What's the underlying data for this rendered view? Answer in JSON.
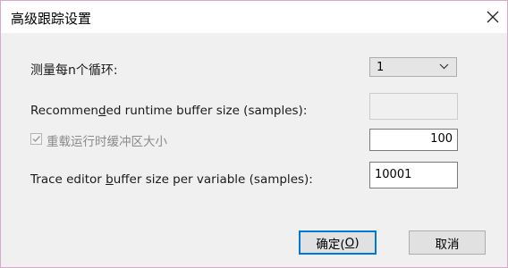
{
  "dialog": {
    "title": "高级跟踪设置"
  },
  "every_n_cycles": {
    "label": "测量每n个循环:",
    "value": "1"
  },
  "recommended_buffer": {
    "label_pre": "Recommen",
    "label_key": "d",
    "label_post": "ed runtime buffer size (samples):",
    "value": ""
  },
  "reload_runtime": {
    "label": "重载运行时缓冲区大小",
    "checked": true,
    "value": "100"
  },
  "editor_buffer": {
    "label_pre": "Trace editor ",
    "label_key": "b",
    "label_post": "uffer size per variable (samples):",
    "value": "10001"
  },
  "buttons": {
    "ok_pre": "确定(",
    "ok_key": "O",
    "ok_post": ")",
    "cancel": "取消"
  },
  "icons": {
    "close": "close-icon",
    "dropdown": "chevron-down-icon",
    "checkmark": "checkmark-icon"
  }
}
